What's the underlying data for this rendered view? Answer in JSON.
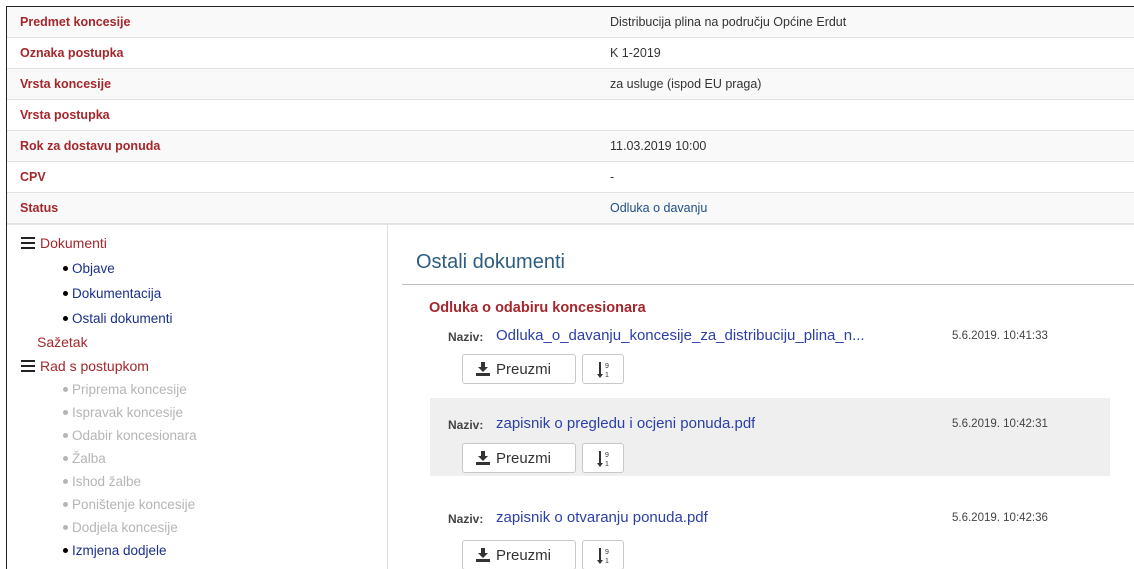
{
  "info_rows": [
    {
      "label": "Predmet koncesije",
      "value": "Distribucija plina na području Općine Erdut"
    },
    {
      "label": "Oznaka postupka",
      "value": "K 1-2019"
    },
    {
      "label": "Vrsta koncesije",
      "value": "za usluge (ispod EU praga)"
    },
    {
      "label": "Vrsta postupka",
      "value": ""
    },
    {
      "label": "Rok za dostavu ponuda",
      "value": "11.03.2019 10:00"
    },
    {
      "label": "CPV",
      "value": "-"
    },
    {
      "label": "Status",
      "value": "Odluka o davanju"
    }
  ],
  "sidebar": {
    "dokumenti": "Dokumenti",
    "dokumenti_items": [
      "Objave",
      "Dokumentacija",
      "Ostali dokumenti"
    ],
    "sazetak": "Sažetak",
    "rad": "Rad s postupkom",
    "rad_items": [
      {
        "label": "Priprema koncesije",
        "disabled": true
      },
      {
        "label": "Ispravak koncesije",
        "disabled": true
      },
      {
        "label": "Odabir koncesionara",
        "disabled": true
      },
      {
        "label": "Žalba",
        "disabled": true
      },
      {
        "label": "Ishod žalbe",
        "disabled": true
      },
      {
        "label": "Poništenje koncesije",
        "disabled": true
      },
      {
        "label": "Dodjela koncesije",
        "disabled": true
      },
      {
        "label": "Izmjena dodjele",
        "disabled": false
      }
    ]
  },
  "content": {
    "title": "Ostali dokumenti",
    "group_title": "Odluka o odabiru koncesionara",
    "naziv_label": "Naziv:",
    "download_label": "Preuzmi",
    "documents": [
      {
        "name": "Odluka_o_davanju_koncesije_za_distribuciju_plina_n...",
        "date": "5.6.2019. 10:41:33"
      },
      {
        "name": "zapisnik o pregledu i ocjeni ponuda.pdf",
        "date": "5.6.2019. 10:42:31"
      },
      {
        "name": "zapisnik o otvaranju ponuda.pdf",
        "date": "5.6.2019. 10:42:36"
      }
    ]
  },
  "colors": {
    "accent_red": "#a3272c",
    "link_blue": "#2b3fa8",
    "title_blue": "#2e5d7e"
  }
}
